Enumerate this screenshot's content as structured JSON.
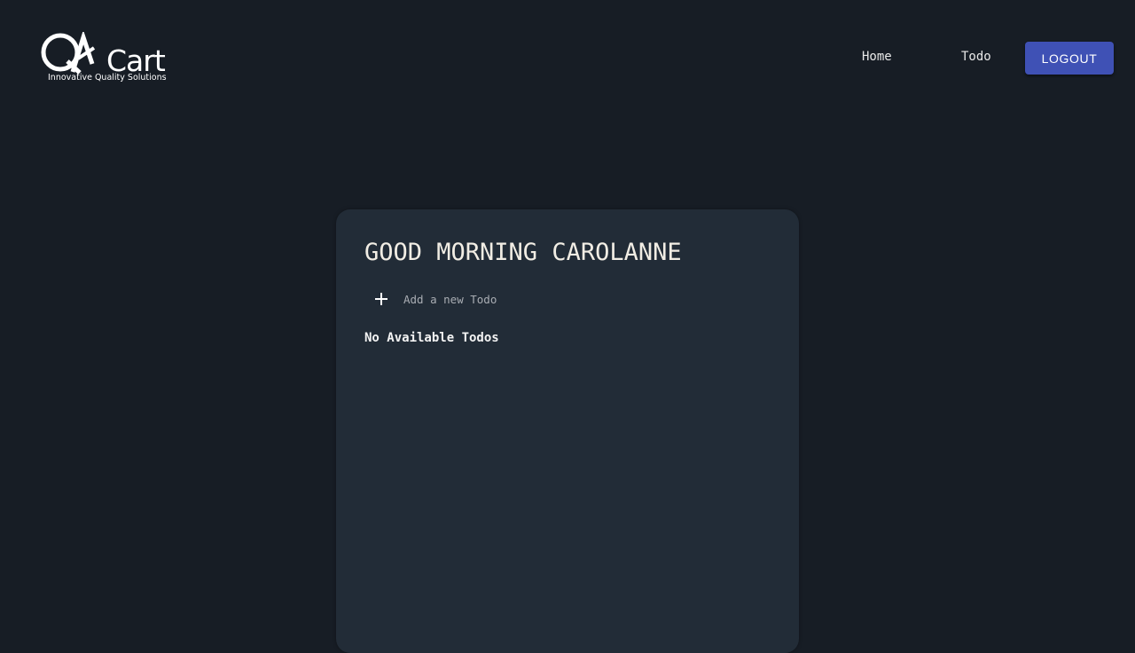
{
  "brand": {
    "logo_text": "QACart",
    "tagline": "Innovative Quality Solutions"
  },
  "nav": {
    "home_label": "Home",
    "todo_label": "Todo",
    "logout_label": "LOGOUT"
  },
  "todo_panel": {
    "greeting": "GOOD MORNING CAROLANNE",
    "add_placeholder": "Add a new Todo",
    "add_value": "",
    "empty_message": "No Available Todos"
  },
  "icons": {
    "add": "plus-icon"
  },
  "colors": {
    "background": "#171d25",
    "card": "#222c37",
    "accent": "#3f51b5",
    "text": "#f1ede4"
  }
}
